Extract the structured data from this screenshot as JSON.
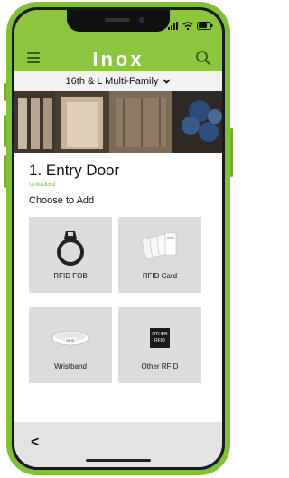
{
  "header": {
    "brand": "Inox"
  },
  "property": {
    "name": "16th & L Multi-Family",
    "chevron": "❯"
  },
  "door": {
    "title": "1. Entry Door",
    "status": "Unlocked"
  },
  "add": {
    "heading": "Choose to Add"
  },
  "credentials": [
    {
      "label": "RFID FOB",
      "icon": "rfid-fob-icon"
    },
    {
      "label": "RFID Card",
      "icon": "rfid-card-icon"
    },
    {
      "label": "Wristband",
      "icon": "wristband-icon",
      "inner_text": "RFID"
    },
    {
      "label": "Other RFID",
      "icon": "other-rfid-icon",
      "inner_text": "OTHER RFID"
    }
  ],
  "nav": {
    "back": "<"
  },
  "colors": {
    "brand_green": "#8cc63f",
    "status_green": "#6fbf2a"
  }
}
